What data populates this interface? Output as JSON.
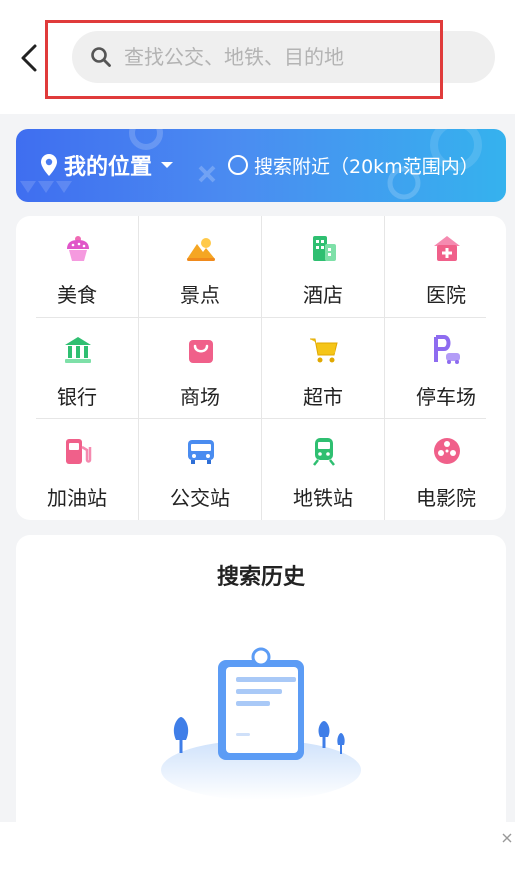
{
  "header": {
    "back_icon": "chevron-left-icon",
    "search": {
      "placeholder": "查找公交、地铁、目的地",
      "value": "",
      "icon": "search-icon"
    }
  },
  "location_banner": {
    "my_location_label": "我的位置",
    "nearby_label": "搜索附近（20km范围内）",
    "colors": {
      "start": "#3f6ef0",
      "end": "#35b2ee"
    }
  },
  "categories": [
    {
      "label": "美食",
      "icon": "cupcake-icon",
      "color": "#e056c9"
    },
    {
      "label": "景点",
      "icon": "mountain-sun-icon",
      "color": "#f5a623"
    },
    {
      "label": "酒店",
      "icon": "hotel-building-icon",
      "color": "#2fbf71"
    },
    {
      "label": "医院",
      "icon": "hospital-icon",
      "color": "#f0608a"
    },
    {
      "label": "银行",
      "icon": "bank-icon",
      "color": "#2fbf71"
    },
    {
      "label": "商场",
      "icon": "shopping-bag-icon",
      "color": "#f0608a"
    },
    {
      "label": "超市",
      "icon": "shopping-cart-icon",
      "color": "#f5c518"
    },
    {
      "label": "停车场",
      "icon": "parking-icon",
      "color": "#8e6cf0"
    },
    {
      "label": "加油站",
      "icon": "gas-station-icon",
      "color": "#f0608a"
    },
    {
      "label": "公交站",
      "icon": "bus-icon",
      "color": "#4a8cf0"
    },
    {
      "label": "地铁站",
      "icon": "subway-train-icon",
      "color": "#2fbf71"
    },
    {
      "label": "电影院",
      "icon": "film-reel-icon",
      "color": "#f0608a"
    }
  ],
  "history": {
    "title": "搜索历史",
    "illustration": "empty-clipboard-illustration"
  },
  "ad_bar": {
    "close_icon": "close-icon"
  }
}
